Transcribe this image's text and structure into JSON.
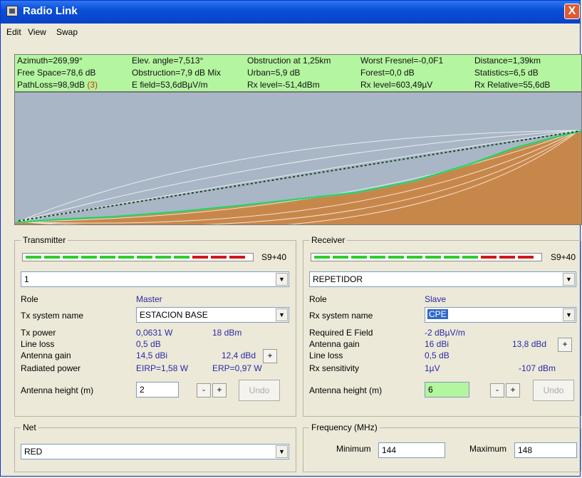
{
  "window": {
    "title": "Radio Link",
    "close": "X"
  },
  "menu": [
    "Edit",
    "View",
    "Swap"
  ],
  "status": [
    [
      "Azimuth=269,99°",
      "Elev. angle=7,513°",
      "Obstruction at 1,25km",
      "Worst Fresnel=-0,0F1",
      "Distance=1,39km"
    ],
    [
      "Free Space=78,6 dB",
      "Obstruction=7,9 dB Mix",
      "Urban=5,9 dB",
      "Forest=0,0 dB",
      "Statistics=6,5 dB"
    ],
    [
      "PathLoss=98,9dB",
      "E field=53,6dBµV/m",
      "Rx level=-51,4dBm",
      "Rx level=603,49µV",
      "Rx Relative=55,6dB"
    ]
  ],
  "status_pathloss_flag": "(3)",
  "transmitter": {
    "label": "Transmitter",
    "meter_label": "S9+40",
    "system": "1",
    "role_label": "Role",
    "role_value": "Master",
    "tx_system_label": "Tx system name",
    "tx_system_value": "ESTACION BASE",
    "tx_power_label": "Tx power",
    "tx_power_w": "0,0631 W",
    "tx_power_dbm": "18 dBm",
    "line_loss_label": "Line loss",
    "line_loss_value": "0,5 dB",
    "antenna_gain_label": "Antenna gain",
    "antenna_gain_dbi": "14,5 dBi",
    "antenna_gain_dbd": "12,4 dBd",
    "radiated_label": "Radiated power",
    "eirp": "EIRP=1,58 W",
    "erp": "ERP=0,97 W",
    "height_label": "Antenna height (m)",
    "height_value": "2",
    "minus": "-",
    "plus": "+",
    "undo": "Undo"
  },
  "receiver": {
    "label": "Receiver",
    "meter_label": "S9+40",
    "system": "REPETIDOR",
    "role_label": "Role",
    "role_value": "Slave",
    "rx_system_label": "Rx system name",
    "rx_system_value": "CPE",
    "req_field_label": "Required E Field",
    "req_field_value": "-2 dBµV/m",
    "antenna_gain_label": "Antenna gain",
    "antenna_gain_dbi": "16 dBi",
    "antenna_gain_dbd": "13,8 dBd",
    "line_loss_label": "Line loss",
    "line_loss_value": "0,5 dB",
    "sens_label": "Rx sensitivity",
    "sens_uv": "1µV",
    "sens_dbm": "-107 dBm",
    "height_label": "Antenna height (m)",
    "height_value": "6",
    "minus": "-",
    "plus": "+",
    "undo": "Undo"
  },
  "net": {
    "label": "Net",
    "value": "RED"
  },
  "frequency": {
    "label": "Frequency (MHz)",
    "min_label": "Minimum",
    "min_value": "144",
    "max_label": "Maximum",
    "max_value": "148"
  },
  "colors": {
    "status_bg": "#b4f5a0",
    "sky": "#a9b6c6",
    "terrain": "#c8874a",
    "meter_green": "#2ecc2e",
    "meter_red": "#d01818",
    "selection": "#316ac5"
  }
}
